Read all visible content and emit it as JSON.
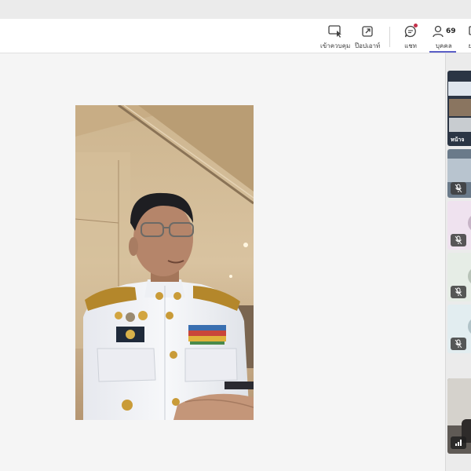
{
  "toolbar": {
    "take_control_label": "เข้าควบคุม",
    "popout_label": "ป๊อปเอาท์",
    "chat_label": "แชท",
    "people_label": "บุคคล",
    "people_count": "69",
    "more_label": "ย"
  },
  "gallery": {
    "tile_label": "หน้าจ"
  },
  "colors": {
    "accent": "#5b5fc7",
    "notification": "#c4314b"
  }
}
